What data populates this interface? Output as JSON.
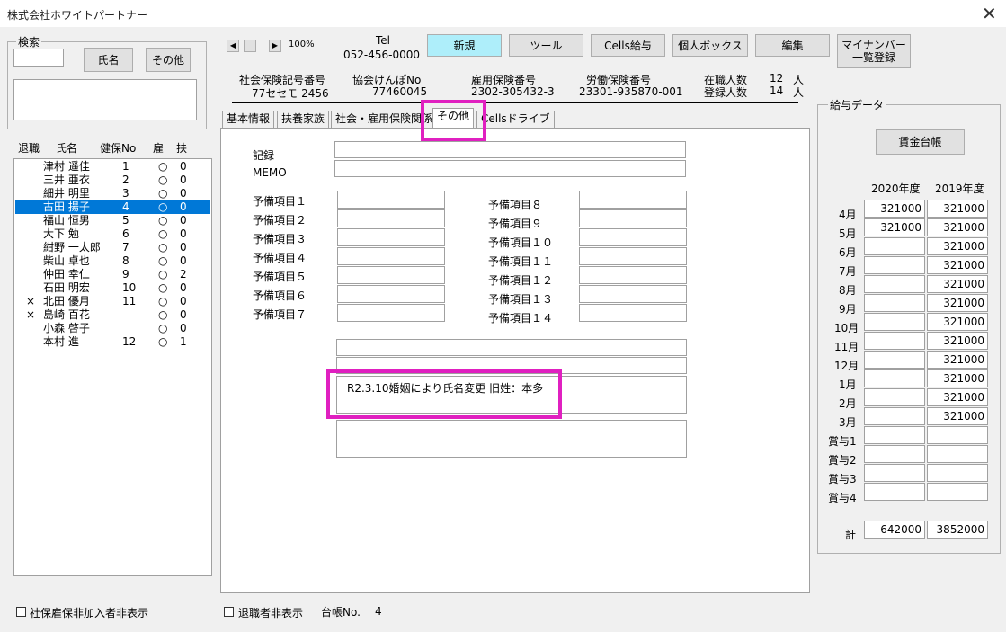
{
  "window": {
    "title": "株式会社ホワイトパートナー",
    "close": "✕"
  },
  "search": {
    "label": "検索",
    "name_button": "氏名",
    "other_button": "その他",
    "value": ""
  },
  "employee_list": {
    "headers": {
      "retired": "退職",
      "name": "氏名",
      "health_no": "健保No",
      "employment": "雇",
      "dependents": "扶"
    },
    "rows": [
      {
        "retired": "",
        "name": "津村 遥佳",
        "no": "1",
        "emp": "○",
        "dep": "0"
      },
      {
        "retired": "",
        "name": "三井 亜衣",
        "no": "2",
        "emp": "○",
        "dep": "0"
      },
      {
        "retired": "",
        "name": "細井 明里",
        "no": "3",
        "emp": "○",
        "dep": "0"
      },
      {
        "retired": "",
        "name": "古田 揚子",
        "no": "4",
        "emp": "○",
        "dep": "0"
      },
      {
        "retired": "",
        "name": "福山 恒男",
        "no": "5",
        "emp": "○",
        "dep": "0"
      },
      {
        "retired": "",
        "name": "大下 勉",
        "no": "6",
        "emp": "○",
        "dep": "0"
      },
      {
        "retired": "",
        "name": "紺野 一太郎",
        "no": "7",
        "emp": "○",
        "dep": "0"
      },
      {
        "retired": "",
        "name": "柴山 卓也",
        "no": "8",
        "emp": "○",
        "dep": "0"
      },
      {
        "retired": "",
        "name": "仲田 幸仁",
        "no": "9",
        "emp": "○",
        "dep": "2"
      },
      {
        "retired": "",
        "name": "石田 明宏",
        "no": "10",
        "emp": "○",
        "dep": "0"
      },
      {
        "retired": "×",
        "name": "北田 優月",
        "no": "11",
        "emp": "○",
        "dep": "0"
      },
      {
        "retired": "×",
        "name": "島崎 百花",
        "no": "",
        "emp": "○",
        "dep": "0"
      },
      {
        "retired": "",
        "name": "小森 啓子",
        "no": "",
        "emp": "○",
        "dep": "0"
      },
      {
        "retired": "",
        "name": "本村 進",
        "no": "12",
        "emp": "○",
        "dep": "1"
      }
    ],
    "selected_index": 3
  },
  "toolbar": {
    "zoom": "100%",
    "tel_label": "Tel",
    "tel_value": "052-456-0000",
    "new": "新規",
    "tools": "ツール",
    "cells_salary": "Cells給与",
    "personal_box": "個人ボックス",
    "edit": "編集",
    "mynumber_line1": "マイナンバー",
    "mynumber_line2": "一覧登録"
  },
  "company_info": {
    "social_ins_label": "社会保険記号番号",
    "social_ins_value": "77セセモ 2456",
    "kyokai_label": "協会けんぽNo",
    "kyokai_value": "77460045",
    "employment_ins_label": "雇用保険番号",
    "employment_ins_value": "2302-305432-3",
    "labor_ins_label": "労働保険番号",
    "labor_ins_value": "23301-935870-001",
    "active_label": "在職人数",
    "active_value": "12",
    "active_unit": "人",
    "registered_label": "登録人数",
    "registered_value": "14",
    "registered_unit": "人"
  },
  "tabs": [
    "基本情報",
    "扶養家族",
    "社会・雇用保険関係",
    "その他",
    "Cellsドライブ"
  ],
  "other_tab": {
    "record_label": "記録",
    "memo_label": "MEMO",
    "reserve_left": [
      "予備項目１",
      "予備項目２",
      "予備項目３",
      "予備項目４",
      "予備項目５",
      "予備項目６",
      "予備項目７"
    ],
    "reserve_right": [
      "予備項目８",
      "予備項目９",
      "予備項目１０",
      "予備項目１１",
      "予備項目１２",
      "予備項目１３",
      "予備項目１４"
    ],
    "note_text": "R2.3.10婚姻により氏名変更  旧姓：本多"
  },
  "salary": {
    "frame_label": "給与データ",
    "ledger_button": "賃金台帳",
    "year1": "2020年度",
    "year2": "2019年度",
    "months": [
      {
        "label": "4月",
        "y1": "321000",
        "y2": "321000"
      },
      {
        "label": "5月",
        "y1": "321000",
        "y2": "321000"
      },
      {
        "label": "6月",
        "y1": "",
        "y2": "321000"
      },
      {
        "label": "7月",
        "y1": "",
        "y2": "321000"
      },
      {
        "label": "8月",
        "y1": "",
        "y2": "321000"
      },
      {
        "label": "9月",
        "y1": "",
        "y2": "321000"
      },
      {
        "label": "10月",
        "y1": "",
        "y2": "321000"
      },
      {
        "label": "11月",
        "y1": "",
        "y2": "321000"
      },
      {
        "label": "12月",
        "y1": "",
        "y2": "321000"
      },
      {
        "label": "1月",
        "y1": "",
        "y2": "321000"
      },
      {
        "label": "2月",
        "y1": "",
        "y2": "321000"
      },
      {
        "label": "3月",
        "y1": "",
        "y2": "321000"
      },
      {
        "label": "賞与1",
        "y1": "",
        "y2": ""
      },
      {
        "label": "賞与2",
        "y1": "",
        "y2": ""
      },
      {
        "label": "賞与3",
        "y1": "",
        "y2": ""
      },
      {
        "label": "賞与4",
        "y1": "",
        "y2": ""
      }
    ],
    "total_label": "計",
    "total_y1": "642000",
    "total_y2": "3852000"
  },
  "footer": {
    "hide_uninsured": "社保雇保非加入者非表示",
    "hide_retired": "退職者非表示",
    "ledger_no_label": "台帳No.",
    "ledger_no_value": "4"
  },
  "colors": {
    "highlight": "#e020c0",
    "selection": "#0078d7",
    "new_button": "#aeeefa"
  }
}
